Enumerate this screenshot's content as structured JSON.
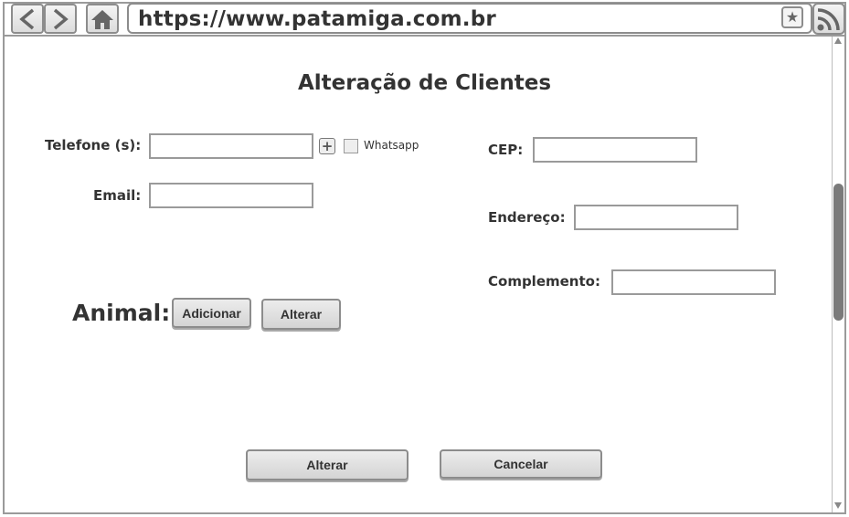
{
  "browser": {
    "url": "https://www.patamiga.com.br"
  },
  "page": {
    "title": "Alteração de Clientes"
  },
  "form": {
    "telefone_label": "Telefone (s):",
    "telefone_value": "",
    "whatsapp_label": "Whatsapp",
    "whatsapp_checked": false,
    "email_label": "Email:",
    "email_value": "",
    "cep_label": "CEP:",
    "cep_value": "",
    "endereco_label": "Endereço:",
    "endereco_value": "",
    "complemento_label": "Complemento:",
    "complemento_value": ""
  },
  "animal": {
    "label": "Animal:",
    "add_label": "Adicionar",
    "edit_label": "Alterar"
  },
  "actions": {
    "submit_label": "Alterar",
    "cancel_label": "Cancelar"
  }
}
